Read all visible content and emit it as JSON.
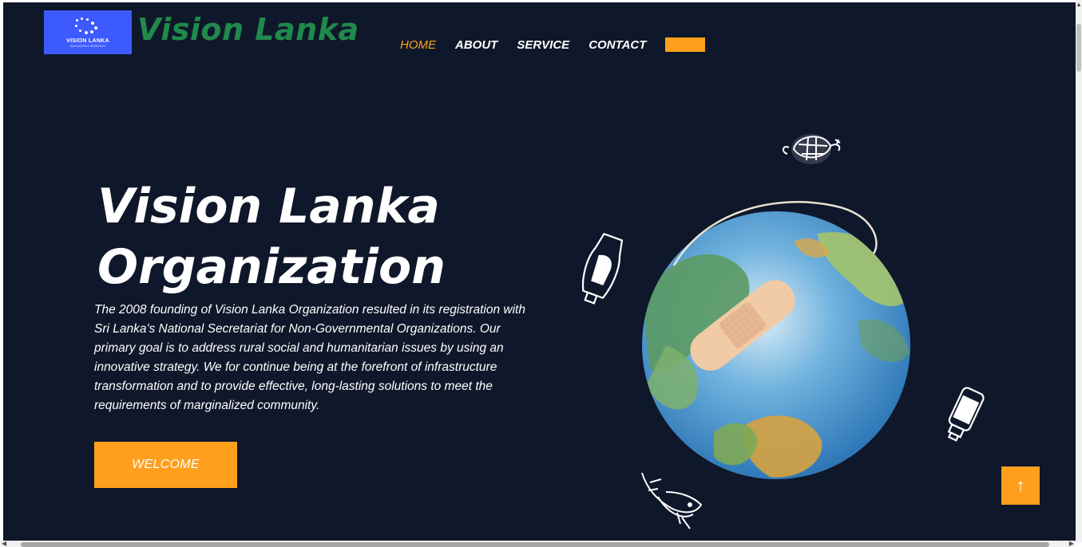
{
  "header": {
    "logo": {
      "title": "VISION LANKA",
      "subtitle": "EDUCATION & RESEARCH"
    },
    "brand": "Vision Lanka"
  },
  "nav": {
    "items": [
      {
        "label": "HOME",
        "active": true
      },
      {
        "label": "ABOUT",
        "active": false
      },
      {
        "label": "SERVICE",
        "active": false
      },
      {
        "label": "CONTACT",
        "active": false
      }
    ]
  },
  "hero": {
    "title_line1": "Vision Lanka",
    "title_line2": "Organization",
    "description": "The 2008 founding of Vision Lanka Organization resulted in its registration with Sri Lanka's National Secretariat for Non-Governmental Organizations. Our primary goal is to address rural social and humanitarian issues by using an innovative strategy. We for continue being at the forefront of infrastructure transformation and to provide effective, long-lasting solutions to meet the requirements of marginalized community.",
    "button_label": "WELCOME"
  },
  "scroll_top": {
    "icon": "arrow-up-icon",
    "glyph": "↑"
  },
  "illustration": {
    "icon": "bandaged-earth-icon"
  },
  "colors": {
    "background": "#0f172a",
    "accent": "#ff9f1c",
    "brand_green": "#1f8a4c",
    "logo_blue": "#3d5afe",
    "active_nav": "#ffa31a"
  }
}
